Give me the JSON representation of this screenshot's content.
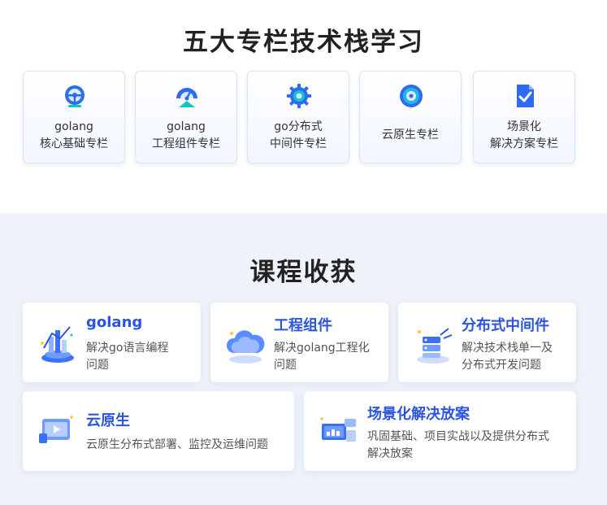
{
  "section1": {
    "title": "五大专栏技术栈学习",
    "columns": [
      {
        "icon": "steering-wheel-icon",
        "line1": "golang",
        "line2": "核心基础专栏"
      },
      {
        "icon": "gauge-icon",
        "line1": "golang",
        "line2": "工程组件专栏"
      },
      {
        "icon": "gear-icon",
        "line1": "go分布式",
        "line2": "中间件专栏"
      },
      {
        "icon": "disc-icon",
        "line1": "云原生专栏",
        "line2": ""
      },
      {
        "icon": "document-check-icon",
        "line1": "场景化",
        "line2": "解决方案专栏"
      }
    ]
  },
  "section2": {
    "title": "课程收获",
    "cards": [
      {
        "icon": "chart-stack-icon",
        "title": "golang",
        "desc1": "解决go语言编程",
        "desc2": "问题"
      },
      {
        "icon": "cloud-icon",
        "title": "工程组件",
        "desc1": "解决golang工程化",
        "desc2": "问题"
      },
      {
        "icon": "server-network-icon",
        "title": "分布式中间件",
        "desc1": "解决技术栈单一及",
        "desc2": "分布式开发问题"
      },
      {
        "icon": "video-window-icon",
        "title": "云原生",
        "desc1": "云原生分布式部署、监控及运维问题",
        "desc2": ""
      },
      {
        "icon": "dashboard-icon",
        "title": "场景化解决放案",
        "desc1": "巩固基础、项目实战以及提供分布式",
        "desc2": "解决放案"
      }
    ]
  }
}
